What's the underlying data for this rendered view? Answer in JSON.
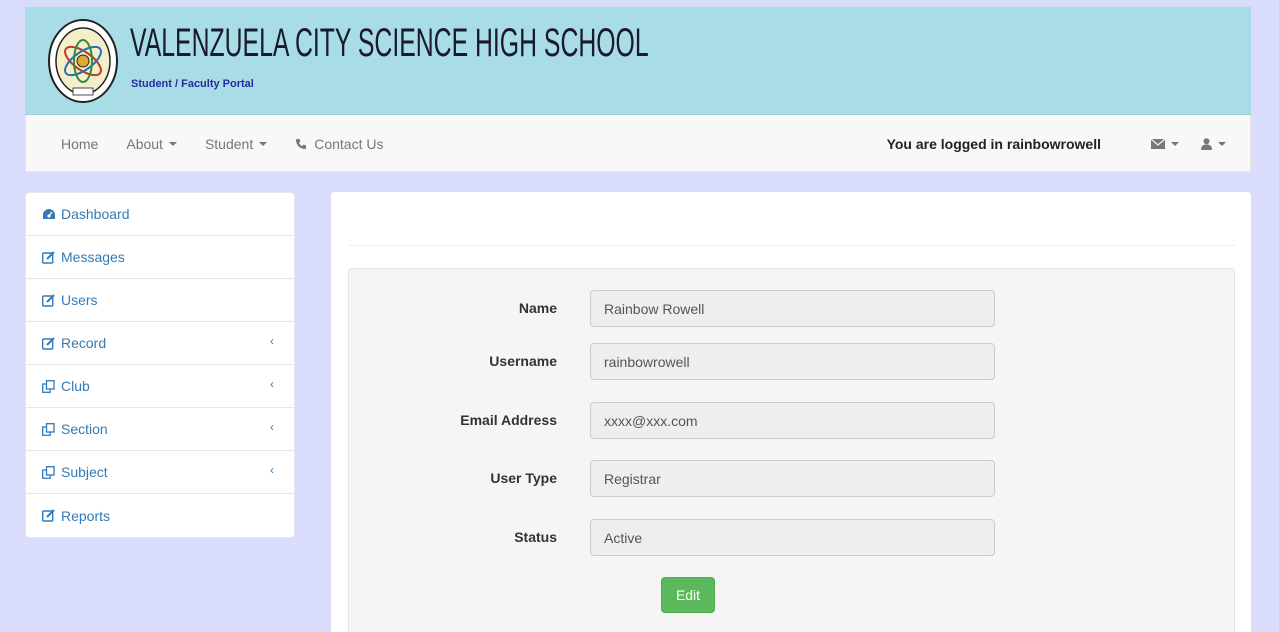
{
  "header": {
    "school_name": "VALENZUELA CITY SCIENCE HIGH SCHOOL",
    "portal_subtitle": "Student / Faculty Portal",
    "seal_text": "VALENZUELA CITY SCIENCE HIGH SCHOOL 2003"
  },
  "navbar": {
    "home": "Home",
    "about": "About",
    "student": "Student",
    "contact": "Contact Us",
    "logged_in_text": "You are logged in rainbowrowell"
  },
  "sidebar": {
    "items": [
      {
        "label": "Dashboard",
        "icon": "dashboard-icon",
        "submenu": false
      },
      {
        "label": "Messages",
        "icon": "edit-icon",
        "submenu": false
      },
      {
        "label": "Users",
        "icon": "edit-icon",
        "submenu": false
      },
      {
        "label": "Record",
        "icon": "edit-icon",
        "submenu": true
      },
      {
        "label": "Club",
        "icon": "copy-icon",
        "submenu": true
      },
      {
        "label": "Section",
        "icon": "copy-icon",
        "submenu": true
      },
      {
        "label": "Subject",
        "icon": "copy-icon",
        "submenu": true
      },
      {
        "label": "Reports",
        "icon": "edit-icon",
        "submenu": false
      }
    ]
  },
  "profile": {
    "fields": [
      {
        "label": "Name",
        "value": "Rainbow Rowell"
      },
      {
        "label": "Username",
        "value": "rainbowrowell"
      },
      {
        "label": "Email Address",
        "value": "xxxx@xxx.com"
      },
      {
        "label": "User Type",
        "value": "Registrar"
      },
      {
        "label": "Status",
        "value": "Active"
      }
    ],
    "edit_label": "Edit"
  },
  "colors": {
    "banner": "#a8dde7",
    "page_bg": "#d9dcfb",
    "link": "#337ab7",
    "button": "#5cb85c"
  }
}
